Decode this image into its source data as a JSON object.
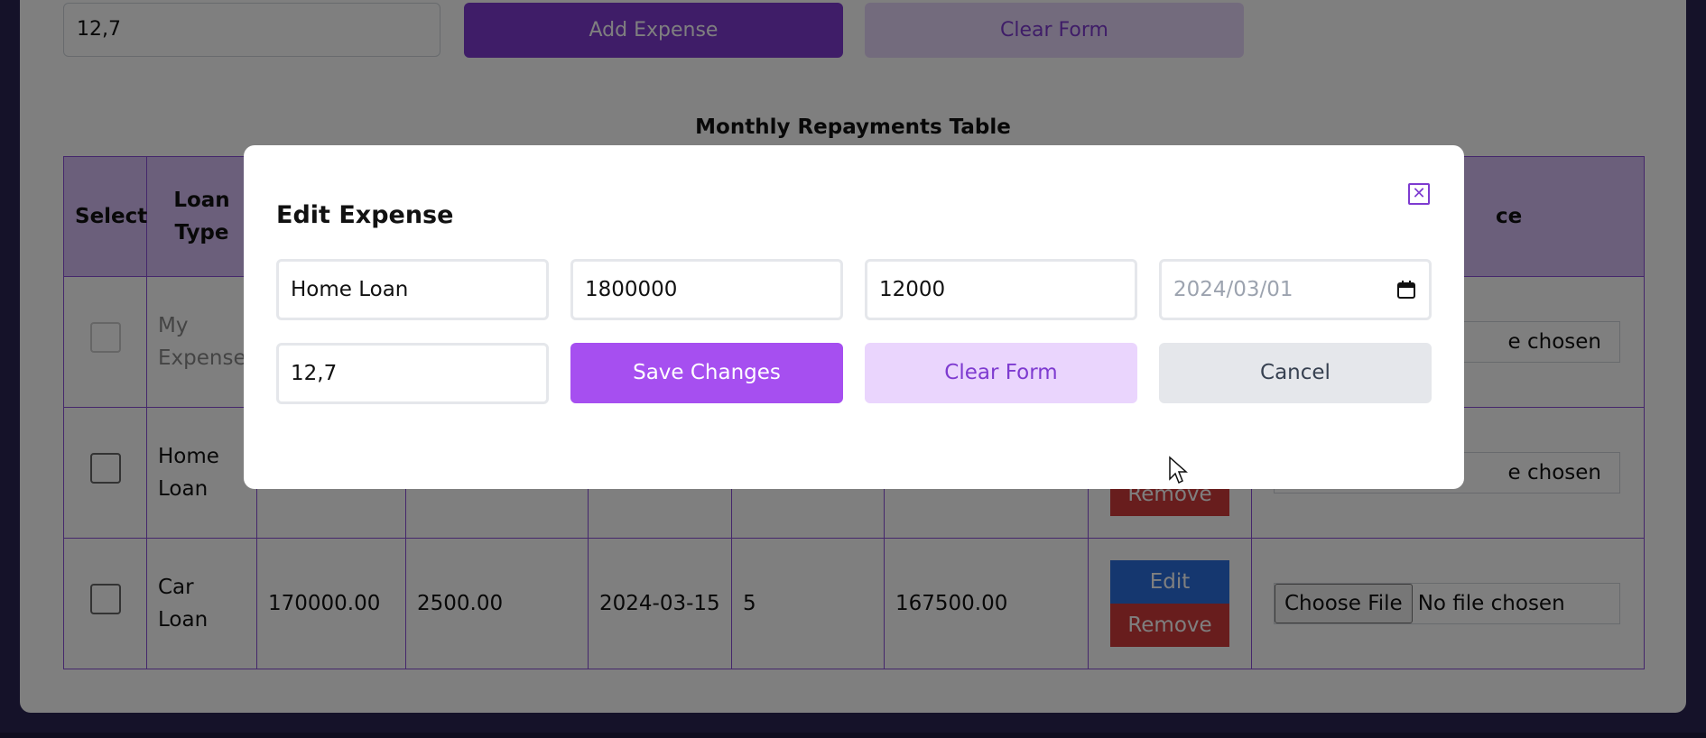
{
  "background_form": {
    "rate_value": "12,7",
    "add_label": "Add Expense",
    "clear_label": "Clear Form"
  },
  "table": {
    "title": "Monthly Repayments Table",
    "headers": {
      "select": "Select",
      "loan_type": "Loan Type",
      "last": "ce"
    },
    "rows": [
      {
        "loan_type": "My Expense",
        "file_text": "e chosen"
      },
      {
        "loan_type": "Home Loan",
        "remove": "Remove",
        "file_text": "e chosen"
      },
      {
        "loan_type": "Car Loan",
        "amount": "170000.00",
        "payment": "2500.00",
        "date": "2024-03-15",
        "rate": "5",
        "balance": "167500.00",
        "edit": "Edit",
        "remove": "Remove",
        "file_button": "Choose File",
        "file_text": "No file chosen"
      }
    ]
  },
  "modal": {
    "title": "Edit Expense",
    "close_icon": "close-x-icon",
    "fields": {
      "loan_type": "Home Loan",
      "amount": "1800000",
      "payment": "12000",
      "date": "2024/03/01",
      "rate": "12,7"
    },
    "save_label": "Save Changes",
    "clear_label": "Clear Form",
    "cancel_label": "Cancel"
  },
  "colors": {
    "primary": "#a64ff0",
    "primary_dark": "#7e3bd0",
    "table_header": "#d7bef6",
    "edit": "#2b6fde",
    "remove": "#d03b3b"
  }
}
